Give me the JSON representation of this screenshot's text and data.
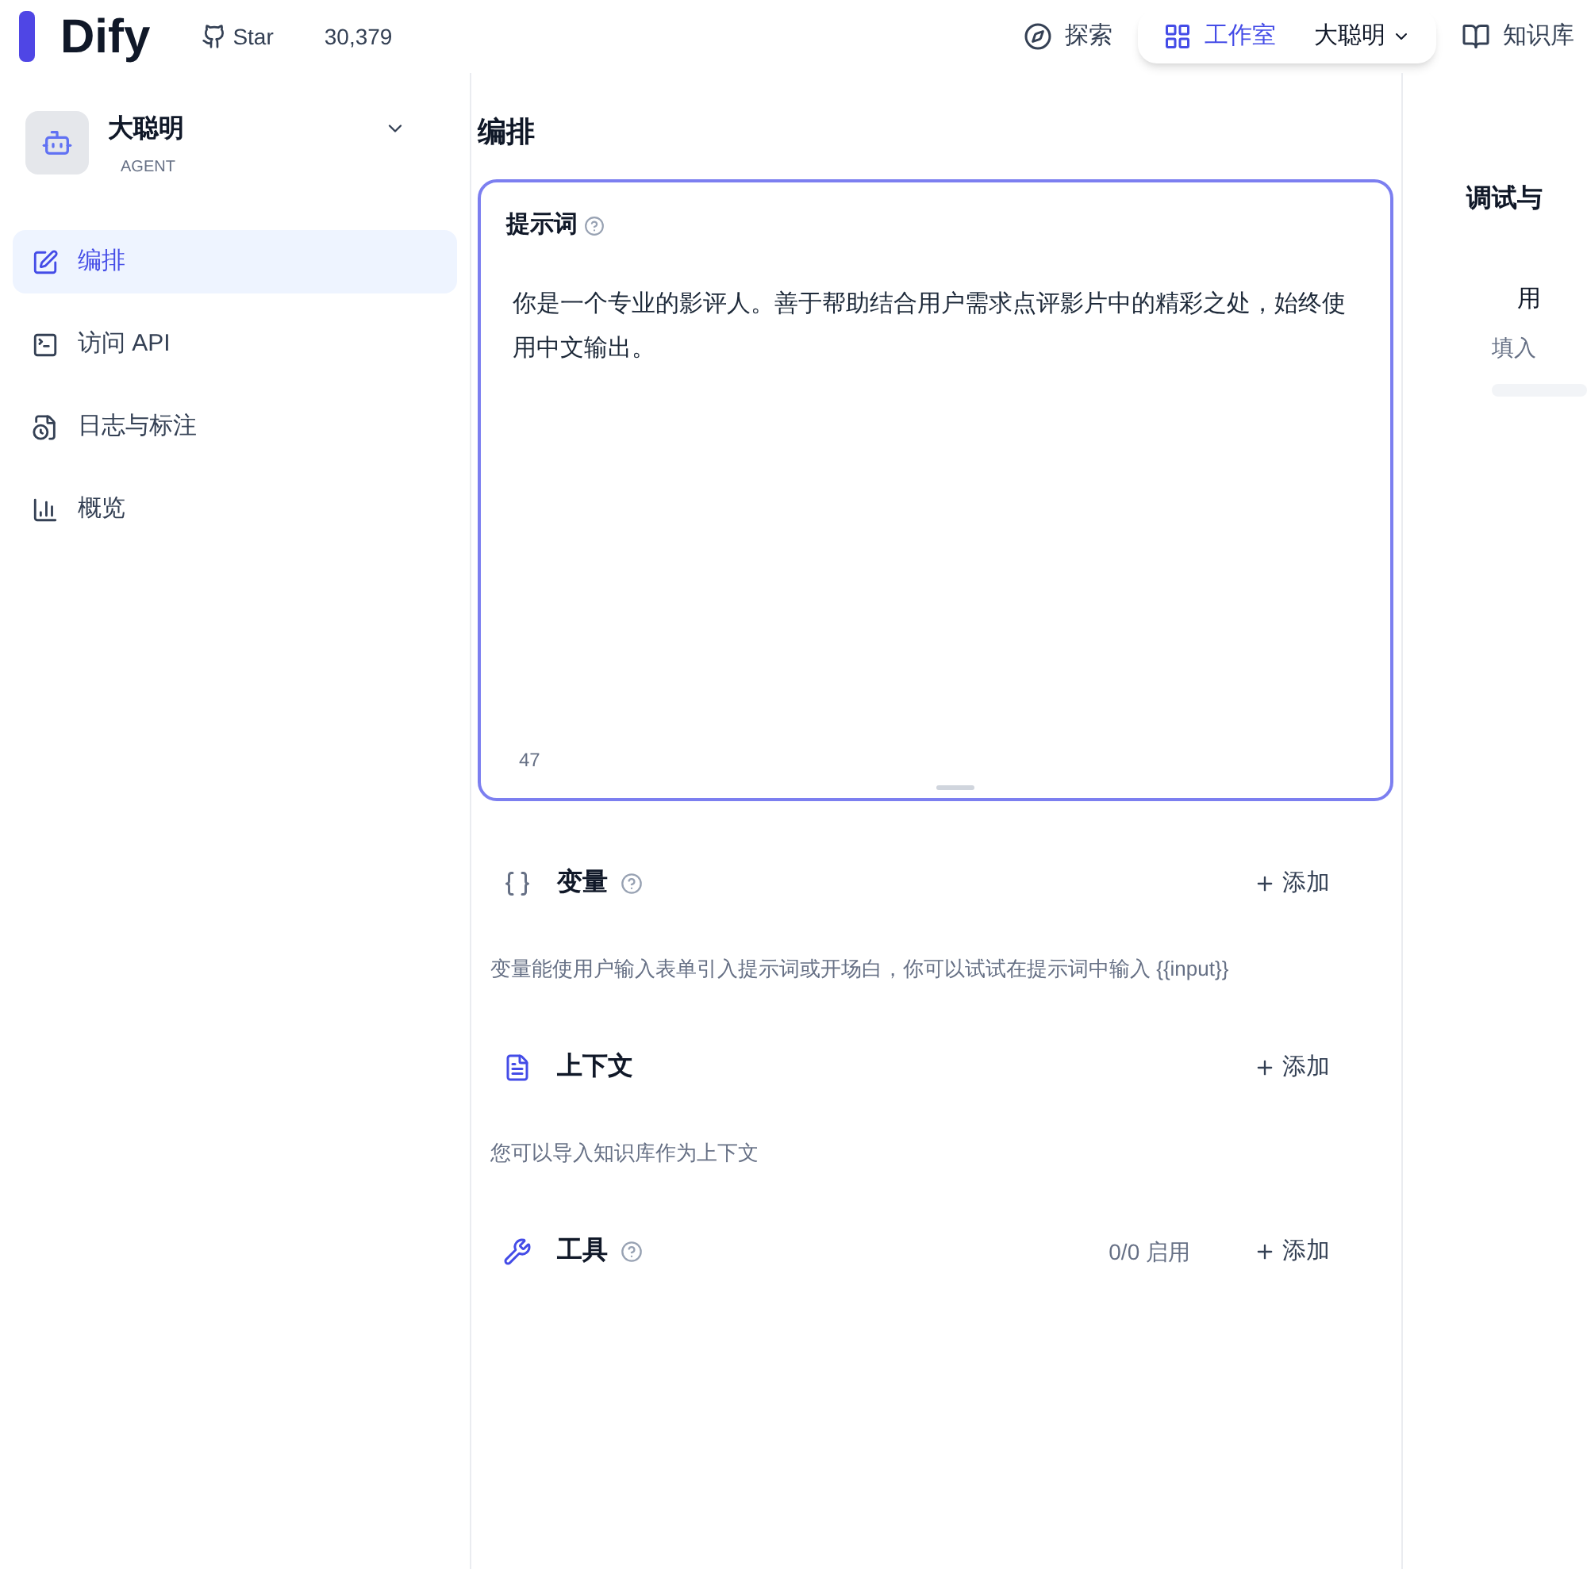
{
  "header": {
    "logo": "Dify",
    "github": {
      "label": "Star",
      "count": "30,379"
    },
    "nav": [
      {
        "label": "探索",
        "selected": false
      },
      {
        "label": "工作室",
        "selected": true,
        "sub": "大聪明"
      },
      {
        "label": "知识库",
        "selected": false
      }
    ]
  },
  "app": {
    "name": "大聪明",
    "mode": "AGENT"
  },
  "sidebar": {
    "items": [
      {
        "label": "编排",
        "selected": true
      },
      {
        "label": "访问 API",
        "selected": false
      },
      {
        "label": "日志与标注",
        "selected": false
      },
      {
        "label": "概览",
        "selected": false
      }
    ]
  },
  "main": {
    "title": "编排",
    "prompt": {
      "title": "提示词",
      "text": "你是一个专业的影评人。善于帮助结合用户需求点评影片中的精彩之处，始终使用中文输出。",
      "count": "47"
    },
    "sections": [
      {
        "kind": "variables",
        "title": "变量",
        "add": "添加",
        "description": "变量能使用户输入表单引入提示词或开场白，你可以试试在提示词中输入 {{input}}"
      },
      {
        "kind": "context",
        "title": "上下文",
        "add": "添加",
        "description": "您可以导入知识库作为上下文"
      },
      {
        "kind": "tools",
        "title": "工具",
        "add": "添加",
        "status": "0/0 启用"
      }
    ]
  },
  "preview": {
    "title": "调试与",
    "label": "用",
    "hint": "填入"
  }
}
